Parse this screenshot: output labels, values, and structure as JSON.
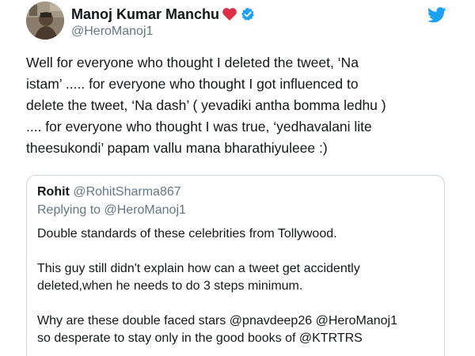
{
  "tweet": {
    "author_name": "Manoj Kumar Manchu",
    "author_handle": "@HeroManoj1",
    "text_lines": [
      "Well for everyone who thought I deleted the tweet, ‘Na",
      "istam’ ..... for everyone who thought I got influenced to",
      "delete the tweet, ‘Na dash’ ( yevadiki antha bomma ledhu )",
      ".... for everyone who thought I was true, ‘yedhavalani lite",
      "theesukondi’ papam vallu mana bharathiyuleee :)"
    ],
    "icons": {
      "heart": "red-heart-icon",
      "verified": "verified-badge-icon",
      "brand": "twitter-bird-icon"
    }
  },
  "quoted_tweet": {
    "author_name": "Rohit",
    "author_handle": "@RohitSharma867",
    "replying_to": "Replying to @HeroManoj1",
    "paragraphs": [
      [
        "Double standards of these celebrities from Tollywood."
      ],
      [
        "This guy still didn't explain how can a tweet get accidently",
        "deleted,when he needs to do 3 steps minimum."
      ],
      [
        "Why are these double faced stars @pnavdeep26 @HeroManoj1",
        "so desperate to stay only in the good books of @KTRTRS"
      ]
    ]
  },
  "colors": {
    "heart": "#dd2e44",
    "verified": "#1da1f2",
    "twitter_blue": "#1da1f2",
    "secondary_text": "#657786",
    "border": "#ccd6dd"
  }
}
